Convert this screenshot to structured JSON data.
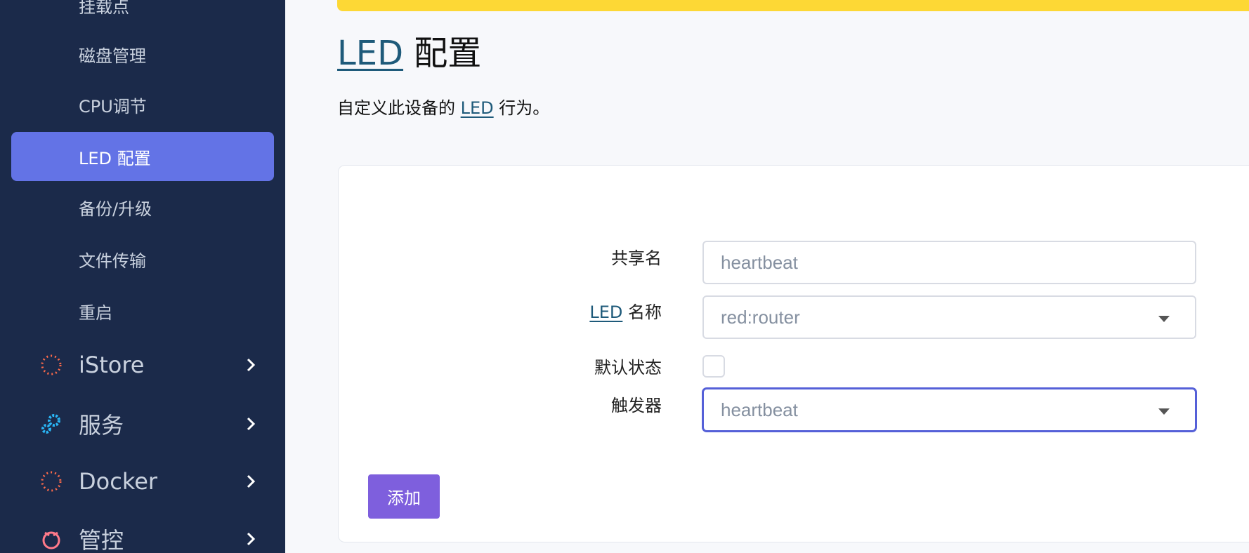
{
  "sidebar": {
    "items": [
      {
        "label": "挂载点"
      },
      {
        "label": "磁盘管理"
      },
      {
        "label": "CPU调节"
      },
      {
        "label": "LED 配置",
        "active": true
      },
      {
        "label": "备份/升级"
      },
      {
        "label": "文件传输"
      },
      {
        "label": "重启"
      }
    ],
    "groups": [
      {
        "label": "iStore",
        "icon": "istore-icon"
      },
      {
        "label": "服务",
        "icon": "gears-icon"
      },
      {
        "label": "Docker",
        "icon": "docker-icon"
      },
      {
        "label": "管控",
        "icon": "control-icon"
      }
    ]
  },
  "page": {
    "title_abbr": "LED",
    "title_rest": "配置",
    "desc_before": "自定义此设备的",
    "desc_abbr": "LED",
    "desc_after": "行为。"
  },
  "form": {
    "name_label": "共享名",
    "name_placeholder": "heartbeat",
    "led_label_abbr": "LED",
    "led_label_rest": "名称",
    "led_value": "red:router",
    "default_label": "默认状态",
    "default_checked": false,
    "trigger_label": "触发器",
    "trigger_value": "heartbeat",
    "add_label": "添加"
  },
  "colors": {
    "sidebar_bg": "#1b2a4a",
    "active_bg": "#6373e6",
    "warning": "#fdd835",
    "button": "#7e5fdd",
    "link": "#1e5a7a"
  }
}
